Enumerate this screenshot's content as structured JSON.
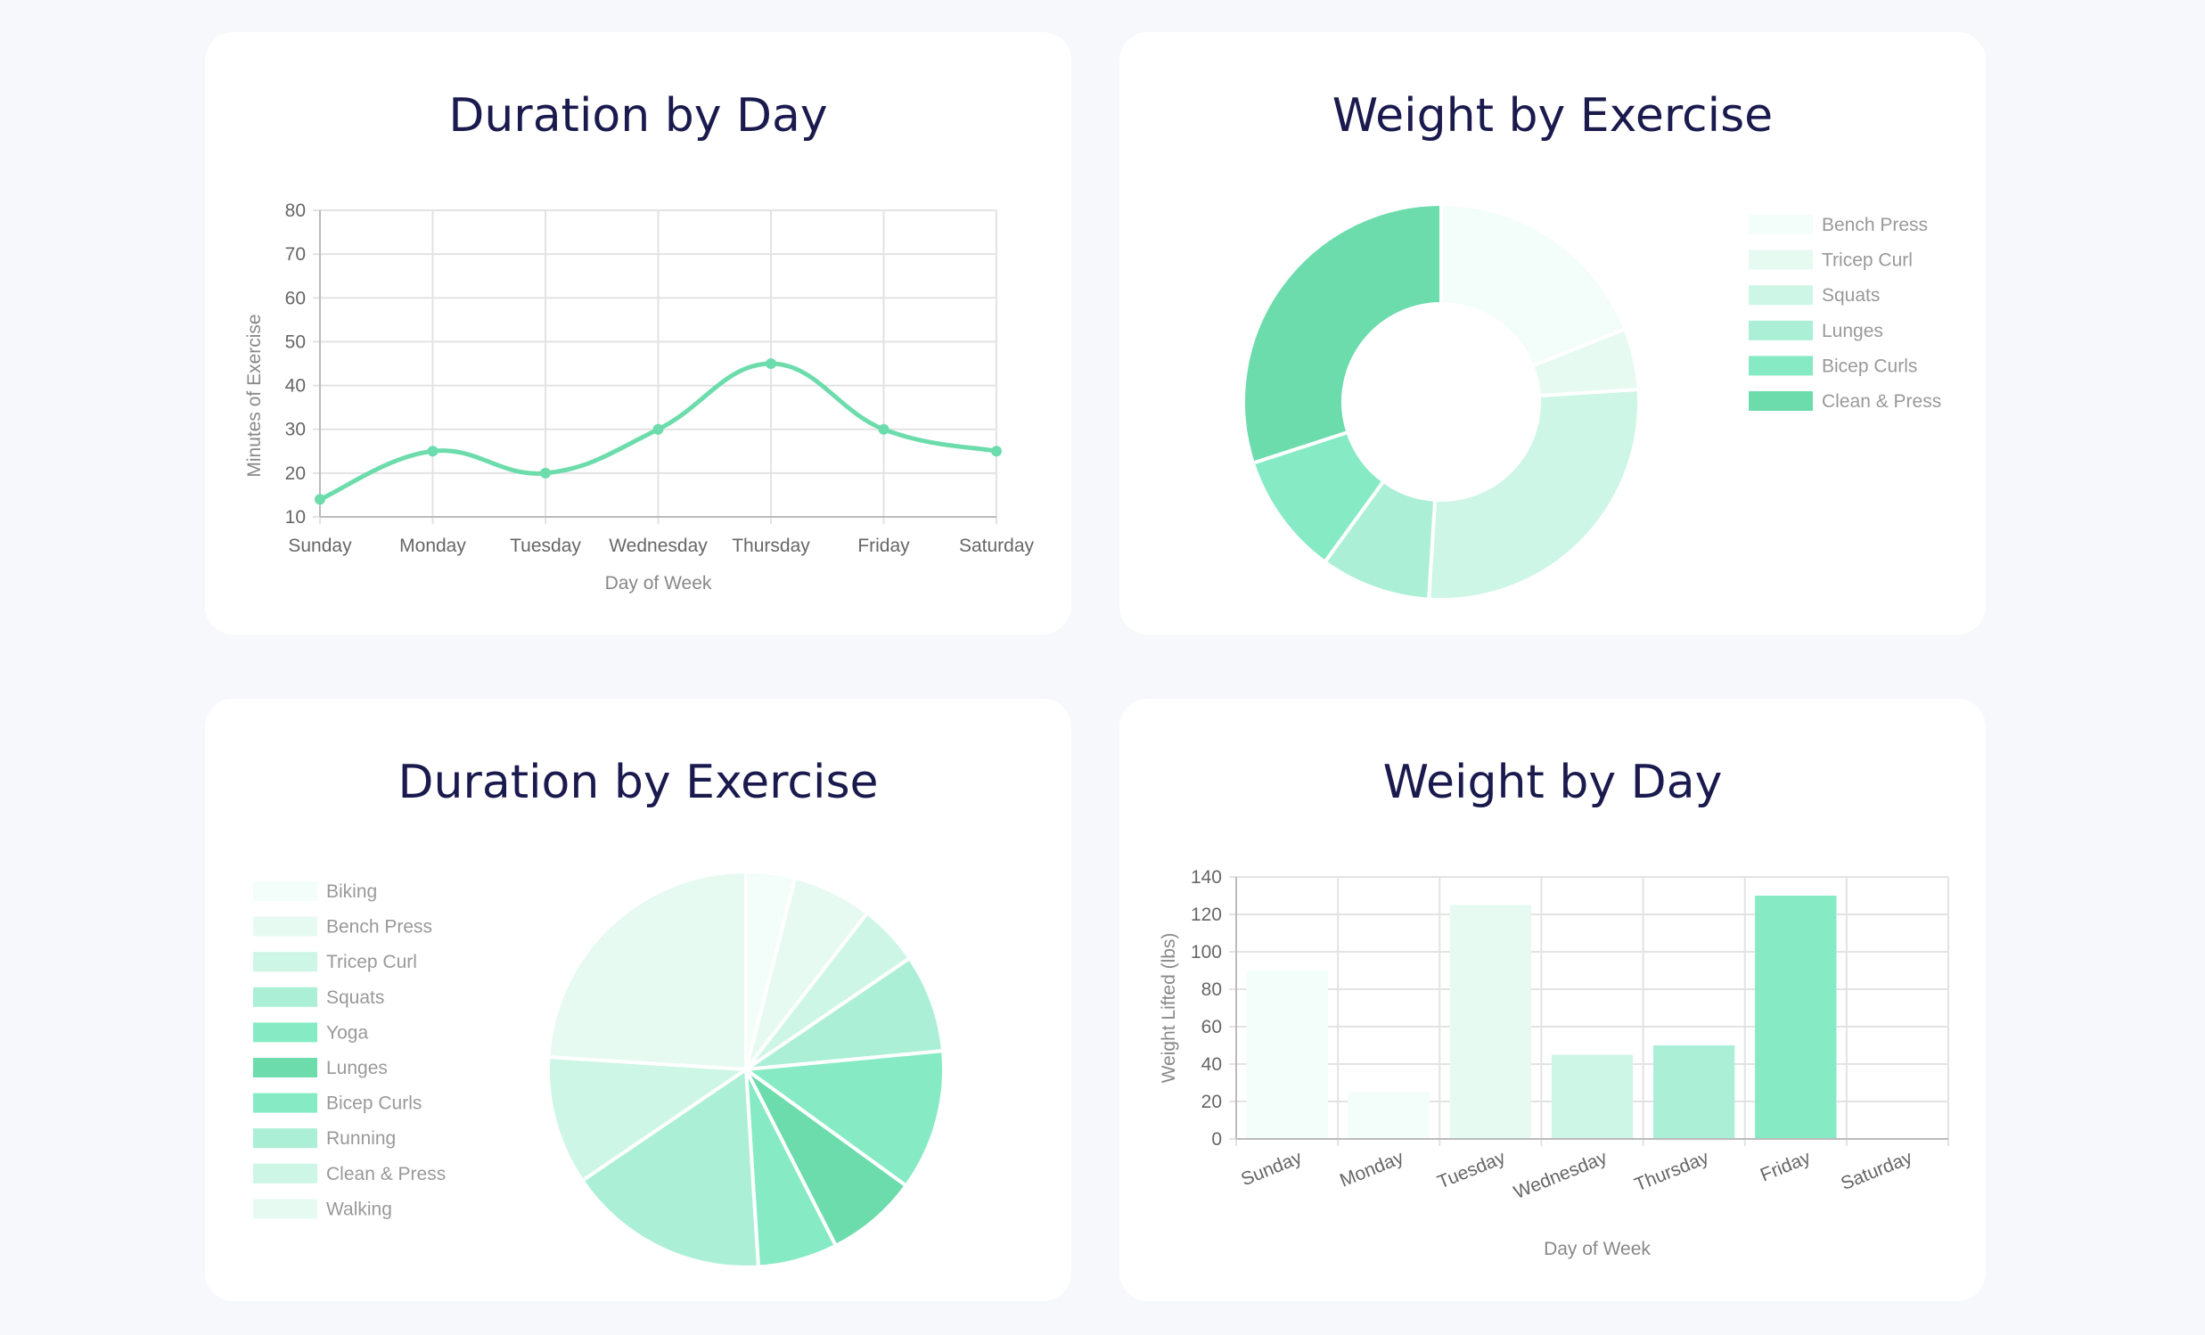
{
  "chart_data": [
    {
      "type": "line",
      "title": "Duration by Day",
      "xlabel": "Day of Week",
      "ylabel": "Minutes of Exercise",
      "categories": [
        "Sunday",
        "Monday",
        "Tuesday",
        "Wednesday",
        "Thursday",
        "Friday",
        "Saturday"
      ],
      "values": [
        14,
        25,
        20,
        30,
        45,
        30,
        25
      ],
      "ylim": [
        10,
        80
      ],
      "yticks": [
        10,
        20,
        30,
        40,
        50,
        60,
        70,
        80
      ],
      "grid": true,
      "color": "#6ddcac"
    },
    {
      "type": "pie",
      "donut": true,
      "title": "Weight by Exercise",
      "labels": [
        "Bench Press",
        "Tricep Curl",
        "Squats",
        "Lunges",
        "Bicep Curls",
        "Clean & Press"
      ],
      "values": [
        19,
        5,
        27,
        9,
        10,
        30
      ],
      "colors": [
        "#f3fdf9",
        "#e6faf2",
        "#cdf6e6",
        "#acefd7",
        "#86ebc5",
        "#6ddcac"
      ],
      "legend": "right"
    },
    {
      "type": "pie",
      "title": "Duration by Exercise",
      "labels": [
        "Biking",
        "Bench Press",
        "Tricep Curl",
        "Squats",
        "Yoga",
        "Lunges",
        "Bicep Curls",
        "Running",
        "Clean & Press",
        "Walking"
      ],
      "values": [
        4,
        6.5,
        5,
        8,
        11.5,
        7.5,
        6.5,
        16.5,
        10.5,
        24
      ],
      "colors": [
        "#f3fdf9",
        "#e6faf2",
        "#cdf6e6",
        "#acefd7",
        "#86ebc5",
        "#6ddcac",
        "#86ebc5",
        "#acefd7",
        "#cdf6e6",
        "#e6faf2"
      ],
      "legend": "left"
    },
    {
      "type": "bar",
      "title": "Weight by Day",
      "xlabel": "Day of Week",
      "ylabel": "Weight Lifted (lbs)",
      "categories": [
        "Sunday",
        "Monday",
        "Tuesday",
        "Wednesday",
        "Thursday",
        "Friday",
        "Saturday"
      ],
      "values": [
        90,
        25,
        125,
        45,
        50,
        130,
        0
      ],
      "ylim": [
        0,
        140
      ],
      "yticks": [
        0,
        20,
        40,
        60,
        80,
        100,
        120,
        140
      ],
      "colors": [
        "#f3fdf9",
        "#f3fdf9",
        "#e6faf2",
        "#cdf6e6",
        "#acefd7",
        "#86ebc5",
        "#6ddcac"
      ],
      "grid": true
    }
  ]
}
